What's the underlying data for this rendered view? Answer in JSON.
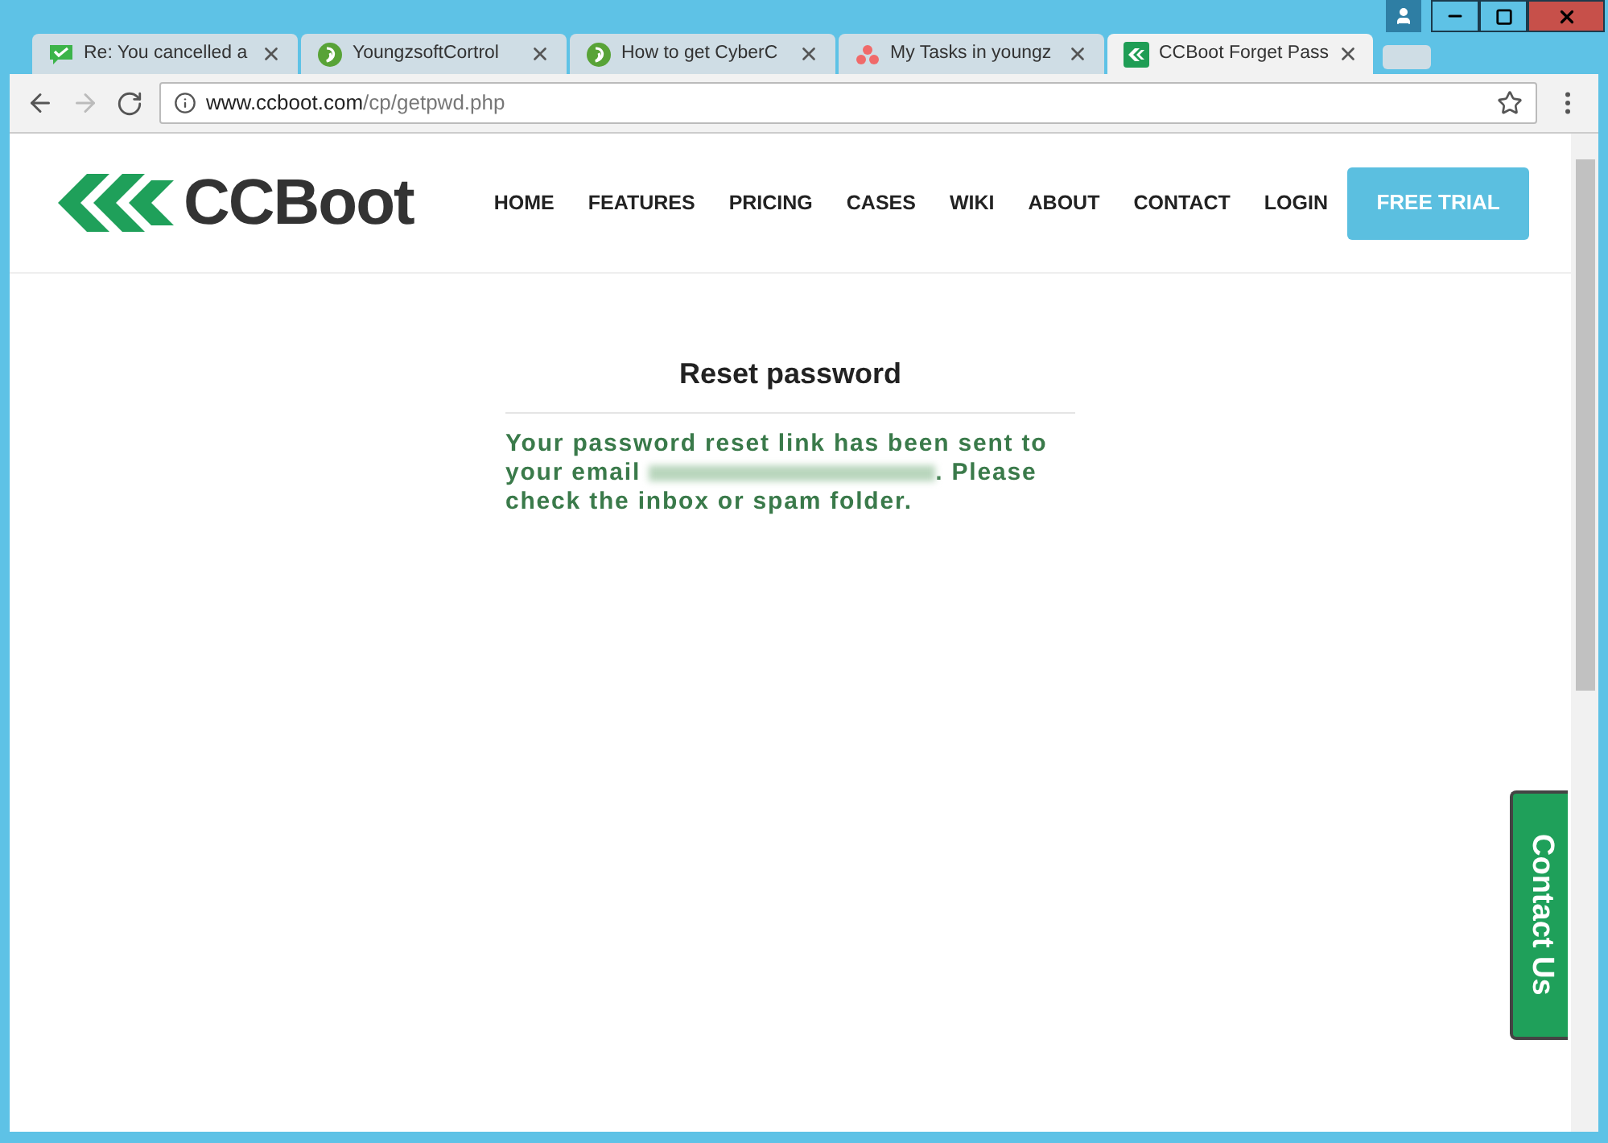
{
  "tabs": [
    {
      "title": "Re: You cancelled a",
      "kind": "chat",
      "selected": false
    },
    {
      "title": "YoungzsoftCortrol",
      "kind": "leaf",
      "selected": false
    },
    {
      "title": "How to get CyberC",
      "kind": "leaf",
      "selected": false
    },
    {
      "title": "My Tasks in youngz",
      "kind": "dots",
      "selected": false
    },
    {
      "title": "CCBoot Forget Pass",
      "kind": "ccboot",
      "selected": true
    }
  ],
  "address_bar": {
    "domain": "www.ccboot.com",
    "path": "/cp/getpwd.php"
  },
  "site": {
    "logo": "CCBoot",
    "nav": [
      "HOME",
      "FEATURES",
      "PRICING",
      "CASES",
      "WIKI",
      "ABOUT",
      "CONTACT",
      "LOGIN"
    ],
    "cta": "FREE TRIAL"
  },
  "content": {
    "heading": "Reset password",
    "message_start": "Your password reset link has been sent to your email",
    "message_end": ". Please check the inbox or spam folder."
  },
  "contact_tab": "Contact Us"
}
